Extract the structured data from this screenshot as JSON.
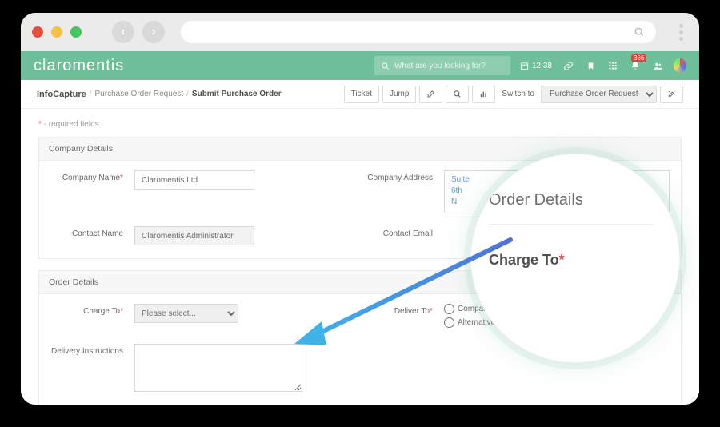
{
  "chrome": {
    "search_placeholder": ""
  },
  "header": {
    "logo": "claromentis",
    "search_placeholder": "What are you looking for?",
    "time": "12:38",
    "notif_count": "366"
  },
  "breadcrumb": {
    "root": "InfoCapture",
    "mid": "Purchase Order Request",
    "leaf": "Submit Purchase Order"
  },
  "toolbar": {
    "ticket": "Ticket",
    "jump": "Jump",
    "switch_to": "Switch to",
    "selector_value": "Purchase Order Request"
  },
  "form": {
    "required_note_prefix": "*",
    "required_note_text": " - required fields",
    "company_details": {
      "title": "Company Details",
      "company_name_label": "Company Name",
      "company_name_value": "Claromentis Ltd",
      "company_address_label": "Company Address",
      "company_address_value": "Suite\n6th\nN",
      "contact_name_label": "Contact Name",
      "contact_name_value": "Claromentis Administrator",
      "contact_email_label": "Contact Email"
    },
    "order_details": {
      "title": "Order Details",
      "charge_to_label": "Charge To",
      "charge_to_placeholder": "Please select...",
      "deliver_to_label": "Deliver To",
      "deliver_to_opt1": "Company Address",
      "deliver_to_opt2": "Alternative Address",
      "delivery_instr_label": "Delivery Instructions"
    }
  },
  "zoom": {
    "heading": "Order Details",
    "field": "Charge To",
    "asterisk": "*"
  }
}
